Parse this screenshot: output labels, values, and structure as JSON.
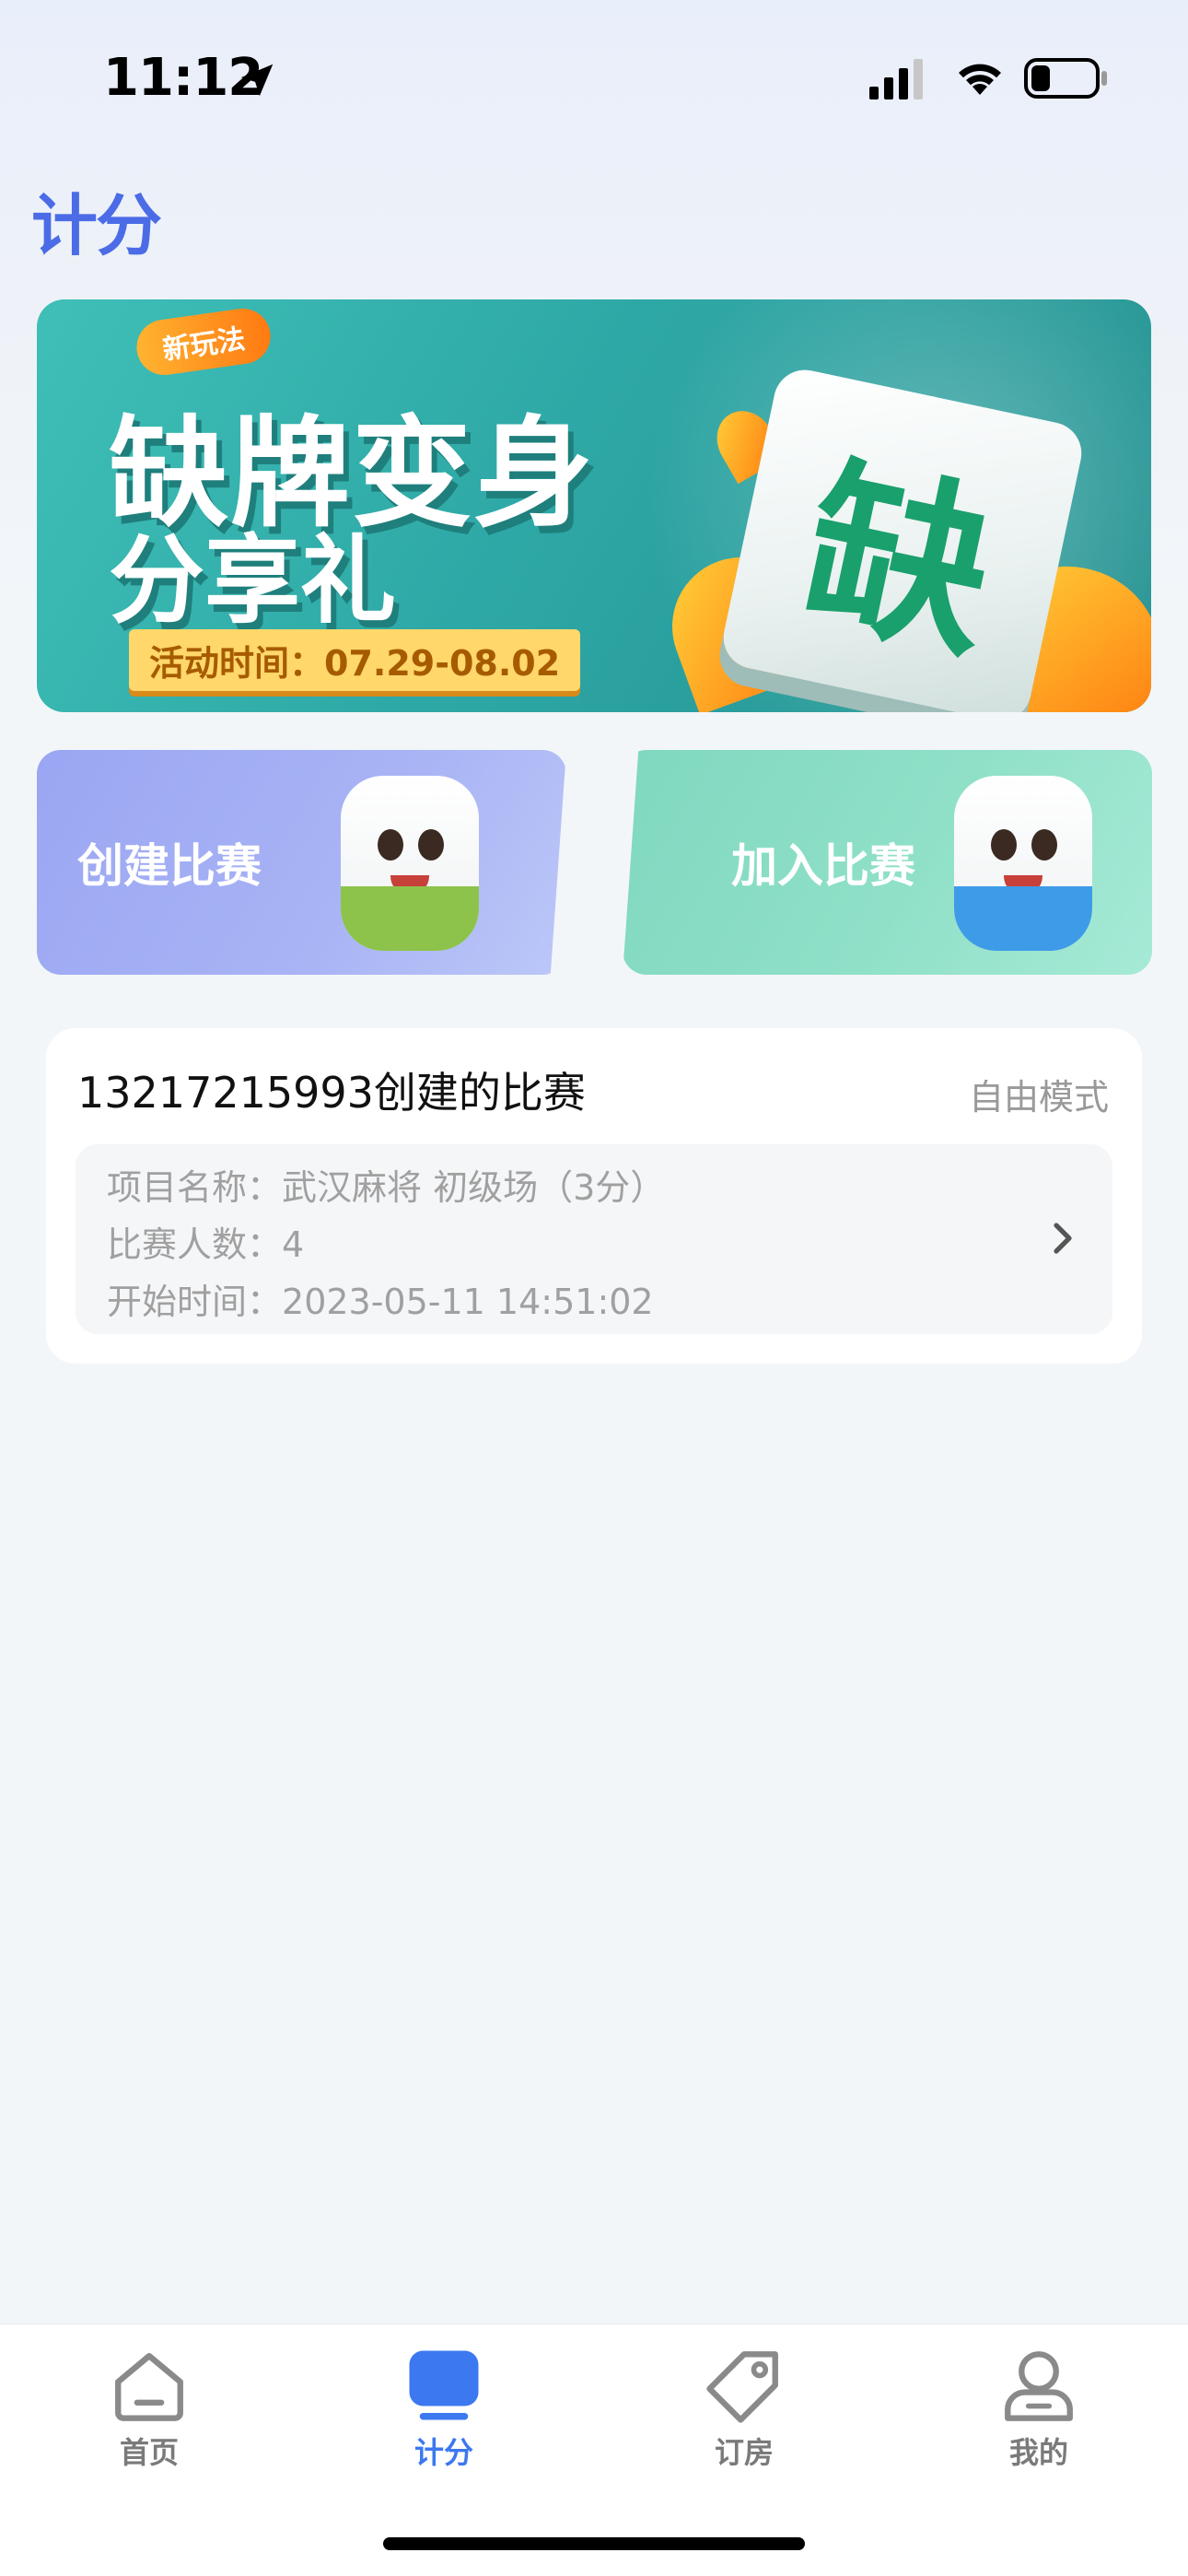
{
  "status_bar": {
    "time": "11:12"
  },
  "header": {
    "logo": "计分"
  },
  "banner": {
    "badge": "新玩法",
    "title_line1": "缺牌变身",
    "title_line2": "分享礼",
    "date": "活动时间：07.29-08.02",
    "tile_char": "缺"
  },
  "actions": {
    "create_label": "创建比赛",
    "join_label": "加入比赛"
  },
  "match": {
    "title": "13217215993创建的比赛",
    "mode": "自由模式",
    "rows": [
      {
        "key": "项目名称：",
        "value": "武汉麻将 初级场（3分）"
      },
      {
        "key": "比赛人数：",
        "value": "4"
      },
      {
        "key": "开始时间：",
        "value": "2023-05-11 14:51:02"
      }
    ]
  },
  "tab_bar": {
    "tabs": [
      {
        "label": "首页",
        "icon": "home-icon",
        "active": false
      },
      {
        "label": "计分",
        "icon": "score-icon",
        "active": true
      },
      {
        "label": "订房",
        "icon": "tag-icon",
        "active": false
      },
      {
        "label": "我的",
        "icon": "profile-icon",
        "active": false
      }
    ]
  },
  "colors": {
    "accent": "#3c78f0",
    "logo": "#4b6ce6",
    "inactive_tab": "#7a7a7a"
  }
}
